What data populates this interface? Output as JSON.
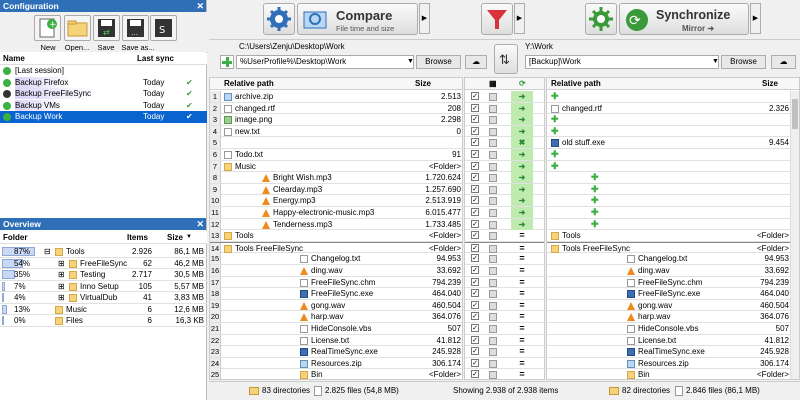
{
  "config": {
    "title": "Configuration",
    "close": "✕",
    "toolbar": [
      "New",
      "Open...",
      "Save",
      "Save as..."
    ],
    "col_name": "Name",
    "col_sync": "Last sync",
    "items": [
      {
        "name": "[Last session]",
        "sync": "",
        "check": ""
      },
      {
        "name": "Backup Firefox",
        "sync": "Today",
        "check": "✔"
      },
      {
        "name": "Backup FreeFileSync",
        "sync": "Today",
        "check": "✔"
      },
      {
        "name": "Backup VMs",
        "sync": "Today",
        "check": "✔"
      },
      {
        "name": "Backup Work",
        "sync": "Today",
        "check": "✔"
      }
    ]
  },
  "overview": {
    "title": "Overview",
    "close": "✕",
    "col_folder": "Folder",
    "col_items": "Items",
    "col_size": "Size",
    "sort": "▼",
    "rows": [
      {
        "pct": "87%",
        "p": 87,
        "name": "Tools",
        "items": "2.926",
        "size": "86,1 MB",
        "expand": "⊟",
        "indent": 0
      },
      {
        "pct": "54%",
        "p": 54,
        "name": "FreeFileSync",
        "items": "62",
        "size": "46,2 MB",
        "expand": "⊞",
        "indent": 1
      },
      {
        "pct": "35%",
        "p": 35,
        "name": "Testing",
        "items": "2.717",
        "size": "30,5 MB",
        "expand": "⊞",
        "indent": 1
      },
      {
        "pct": "7%",
        "p": 7,
        "name": "Inno Setup",
        "items": "105",
        "size": "5,57 MB",
        "expand": "⊞",
        "indent": 1
      },
      {
        "pct": "4%",
        "p": 4,
        "name": "VirtualDub",
        "items": "41",
        "size": "3,83 MB",
        "expand": "⊞",
        "indent": 1
      },
      {
        "pct": "13%",
        "p": 13,
        "name": "Music",
        "items": "6",
        "size": "12,6 MB",
        "expand": "",
        "indent": 0
      },
      {
        "pct": "0%",
        "p": 0,
        "name": "Files",
        "items": "6",
        "size": "16,3 KB",
        "expand": "",
        "indent": 0
      }
    ]
  },
  "compare": {
    "label": "Compare",
    "sub": "File time and size",
    "arrow": "▶"
  },
  "sync": {
    "label": "Synchronize",
    "sub": "Mirror ➜",
    "arrow": "▶"
  },
  "left": {
    "path_hint": "C:\\Users\\Zenju\\Desktop\\Work",
    "path": "%UserProfile%\\Desktop\\Work",
    "browse": "Browse",
    "col_path": "Relative path",
    "col_size": "Size"
  },
  "right": {
    "path_hint": "Y:\\Work",
    "path": "[Backup]\\Work",
    "browse": "Browse",
    "col_path": "Relative path",
    "col_size": "Size"
  },
  "rows": [
    {
      "n": "1",
      "l": "archive.zip",
      "ls": "2.513",
      "lt": "zip",
      "i": 0,
      "act": "➜",
      "r": "",
      "rs": "",
      "rt": ""
    },
    {
      "n": "2",
      "l": "changed.rtf",
      "ls": "208",
      "lt": "file",
      "i": 0,
      "act": "➜",
      "r": "changed.rtf",
      "rs": "2.326",
      "rt": "file"
    },
    {
      "n": "3",
      "l": "image.png",
      "ls": "2.298",
      "lt": "img",
      "i": 0,
      "act": "➜",
      "r": "",
      "rs": "",
      "rt": ""
    },
    {
      "n": "4",
      "l": "new.txt",
      "ls": "0",
      "lt": "file",
      "i": 0,
      "act": "➜",
      "r": "",
      "rs": "",
      "rt": ""
    },
    {
      "n": "5",
      "l": "",
      "ls": "",
      "lt": "",
      "i": 0,
      "act": "✖",
      "r": "old stuff.exe",
      "rs": "9.454",
      "rt": "exe"
    },
    {
      "n": "6",
      "l": "Todo.txt",
      "ls": "91",
      "lt": "file",
      "i": 0,
      "act": "➜",
      "r": "",
      "rs": "",
      "rt": ""
    },
    {
      "n": "7",
      "l": "Music",
      "ls": "<Folder>",
      "lt": "folder",
      "i": 0,
      "act": "➜",
      "r": "",
      "rs": "",
      "rt": ""
    },
    {
      "n": "8",
      "l": "Bright Wish.mp3",
      "ls": "1.720.624",
      "lt": "mp3",
      "i": 1,
      "act": "➜",
      "r": "",
      "rs": "",
      "rt": ""
    },
    {
      "n": "9",
      "l": "Clearday.mp3",
      "ls": "1.257.690",
      "lt": "mp3",
      "i": 1,
      "act": "➜",
      "r": "",
      "rs": "",
      "rt": ""
    },
    {
      "n": "10",
      "l": "Energy.mp3",
      "ls": "2.513.919",
      "lt": "mp3",
      "i": 1,
      "act": "➜",
      "r": "",
      "rs": "",
      "rt": ""
    },
    {
      "n": "11",
      "l": "Happy-electronic-music.mp3",
      "ls": "6.015.477",
      "lt": "mp3",
      "i": 1,
      "act": "➜",
      "r": "",
      "rs": "",
      "rt": ""
    },
    {
      "n": "12",
      "l": "Tenderness.mp3",
      "ls": "1.733.485",
      "lt": "mp3",
      "i": 1,
      "act": "➜",
      "r": "",
      "rs": "",
      "rt": ""
    },
    {
      "n": "13",
      "l": "Tools",
      "ls": "<Folder>",
      "lt": "folder",
      "i": 0,
      "act": "=",
      "r": "Tools",
      "rs": "<Folder>",
      "rt": "folder"
    },
    {
      "n": "14",
      "l": "Tools  FreeFileSync",
      "ls": "<Folder>",
      "lt": "folder",
      "i": 0,
      "act": "=",
      "r": "Tools  FreeFileSync",
      "rs": "<Folder>",
      "rt": "folder"
    },
    {
      "n": "15",
      "l": "Changelog.txt",
      "ls": "94.953",
      "lt": "file",
      "i": 2,
      "act": "=",
      "r": "Changelog.txt",
      "rs": "94.953",
      "rt": "file"
    },
    {
      "n": "16",
      "l": "ding.wav",
      "ls": "33.692",
      "lt": "mp3",
      "i": 2,
      "act": "=",
      "r": "ding.wav",
      "rs": "33.692",
      "rt": "mp3"
    },
    {
      "n": "17",
      "l": "FreeFileSync.chm",
      "ls": "794.239",
      "lt": "file",
      "i": 2,
      "act": "=",
      "r": "FreeFileSync.chm",
      "rs": "794.239",
      "rt": "file"
    },
    {
      "n": "18",
      "l": "FreeFileSync.exe",
      "ls": "464.040",
      "lt": "exe",
      "i": 2,
      "act": "=",
      "r": "FreeFileSync.exe",
      "rs": "464.040",
      "rt": "exe"
    },
    {
      "n": "19",
      "l": "gong.wav",
      "ls": "460.504",
      "lt": "mp3",
      "i": 2,
      "act": "=",
      "r": "gong.wav",
      "rs": "460.504",
      "rt": "mp3"
    },
    {
      "n": "20",
      "l": "harp.wav",
      "ls": "364.076",
      "lt": "mp3",
      "i": 2,
      "act": "=",
      "r": "harp.wav",
      "rs": "364.076",
      "rt": "mp3"
    },
    {
      "n": "21",
      "l": "HideConsole.vbs",
      "ls": "507",
      "lt": "file",
      "i": 2,
      "act": "=",
      "r": "HideConsole.vbs",
      "rs": "507",
      "rt": "file"
    },
    {
      "n": "22",
      "l": "License.txt",
      "ls": "41.812",
      "lt": "file",
      "i": 2,
      "act": "=",
      "r": "License.txt",
      "rs": "41.812",
      "rt": "file"
    },
    {
      "n": "23",
      "l": "RealTimeSync.exe",
      "ls": "245.928",
      "lt": "exe",
      "i": 2,
      "act": "=",
      "r": "RealTimeSync.exe",
      "rs": "245.928",
      "rt": "exe"
    },
    {
      "n": "24",
      "l": "Resources.zip",
      "ls": "306.174",
      "lt": "zip",
      "i": 2,
      "act": "=",
      "r": "Resources.zip",
      "rs": "306.174",
      "rt": "zip"
    },
    {
      "n": "25",
      "l": "Bin",
      "ls": "<Folder>",
      "lt": "folder",
      "i": 2,
      "act": "=",
      "r": "Bin",
      "rs": "<Folder>",
      "rt": "folder"
    }
  ],
  "status": {
    "left_dirs": "83 directories",
    "left_files": "2.825 files (54,8 MB)",
    "showing": "Showing 2.938 of 2.938 items",
    "right_dirs": "82 directories",
    "right_files": "2.846 files (86,1 MB)"
  },
  "colors": {
    "accent": "#2f6fb7",
    "selected": "#0a64d0",
    "green": "#3a9a3a"
  }
}
